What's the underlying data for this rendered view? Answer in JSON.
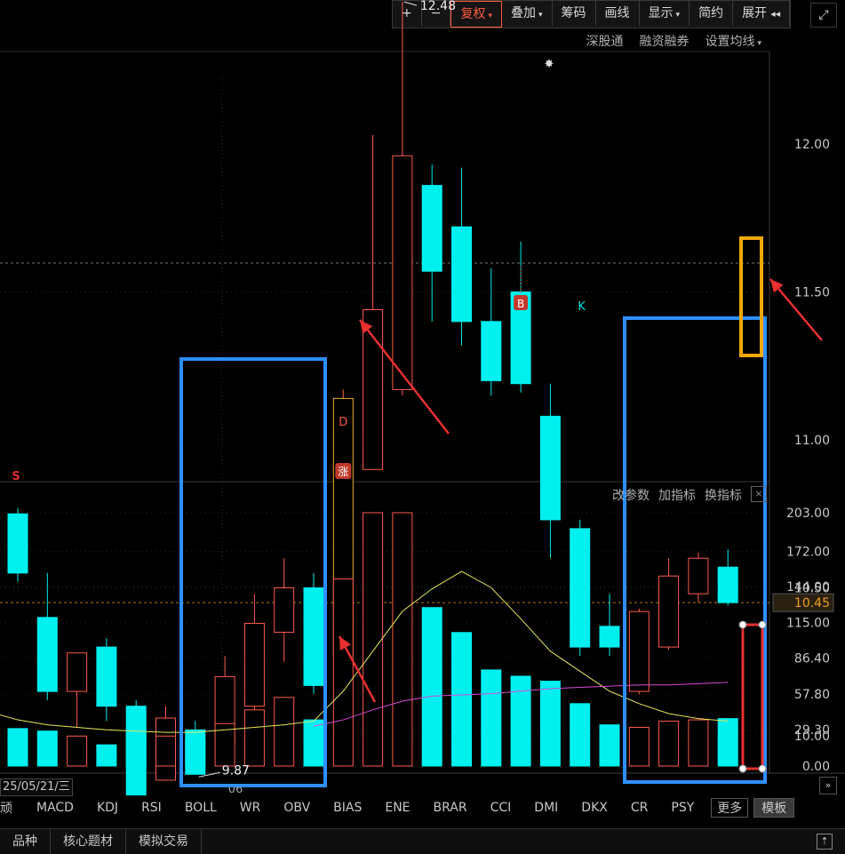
{
  "toolbar": {
    "items": [
      {
        "label": "+",
        "dropdown": false,
        "active": false
      },
      {
        "label": "−",
        "dropdown": false,
        "active": false
      },
      {
        "label": "复权",
        "dropdown": true,
        "active": true
      },
      {
        "label": "叠加",
        "dropdown": true,
        "active": false
      },
      {
        "label": "筹码",
        "dropdown": false,
        "active": false
      },
      {
        "label": "画线",
        "dropdown": false,
        "active": false
      },
      {
        "label": "显示",
        "dropdown": true,
        "active": false
      },
      {
        "label": "简约",
        "dropdown": false,
        "active": false
      },
      {
        "label": "展开",
        "dropdown": false,
        "active": false
      }
    ],
    "expand_arrows": "◂◂"
  },
  "top_links": [
    "深股通",
    "融资融券",
    "设置均线"
  ],
  "indicator_header": [
    "改参数",
    "加指标",
    "换指标"
  ],
  "indicator_close": "×",
  "date_label": "25/05/21/三",
  "month_label": "06",
  "indicator_tabs": [
    "顽",
    "MACD",
    "KDJ",
    "RSI",
    "BOLL",
    "WR",
    "OBV",
    "BIAS",
    "ENE",
    "BRAR",
    "CCI",
    "DMI",
    "DKX",
    "CR",
    "PSY"
  ],
  "tab_more": "更多",
  "tab_template": "模板",
  "bottom_tabs": [
    "品种",
    "核心题材",
    "模拟交易"
  ],
  "colors": {
    "up": "#ff5a4c",
    "down": "#00f0f0",
    "ma_yellow": "#e8e85a",
    "ma_purple": "#d84ad8",
    "price_tag": "#f0a020",
    "box_blue": "#2f8fff",
    "box_orange": "#f0a800",
    "arrow_red": "#e83030"
  },
  "chart_data": {
    "type": "candlestick",
    "price_axis": {
      "ticks": [
        "12.00",
        "11.50",
        "11.00",
        "10.50",
        "10.00"
      ],
      "current_price": "10.45"
    },
    "volume_axis": {
      "ticks": [
        "203.00",
        "172.00",
        "144.00",
        "115.00",
        "86.40",
        "57.80",
        "29.30",
        "0.00"
      ]
    },
    "annotations": {
      "high": "12.48",
      "low": "9.87",
      "markers": [
        "S",
        "D",
        "涨",
        "B",
        "K"
      ]
    },
    "candles": [
      {
        "o": 10.75,
        "h": 10.77,
        "c": 10.55,
        "l": 10.52
      },
      {
        "o": 10.4,
        "h": 10.55,
        "c": 10.15,
        "l": 10.12
      },
      {
        "o": 10.15,
        "h": 10.22,
        "c": 10.28,
        "l": 10.03
      },
      {
        "o": 10.3,
        "h": 10.33,
        "c": 10.1,
        "l": 10.05
      },
      {
        "o": 10.1,
        "h": 10.12,
        "c": 9.8,
        "l": 9.8
      },
      {
        "o": 9.85,
        "h": 10.1,
        "c": 10.06,
        "l": 9.85
      },
      {
        "o": 10.02,
        "h": 10.05,
        "c": 9.87,
        "l": 9.87
      },
      {
        "o": 9.98,
        "h": 10.27,
        "c": 10.2,
        "l": 9.9
      },
      {
        "o": 10.1,
        "h": 10.48,
        "c": 10.38,
        "l": 10.05
      },
      {
        "o": 10.35,
        "h": 10.6,
        "c": 10.5,
        "l": 10.25
      },
      {
        "o": 10.5,
        "h": 10.55,
        "c": 10.17,
        "l": 10.14
      },
      {
        "o": 10.27,
        "h": 11.17,
        "c": 11.14,
        "l": 10.25
      },
      {
        "o": 10.9,
        "h": 12.03,
        "c": 11.44,
        "l": 10.99
      },
      {
        "o": 11.17,
        "h": 12.48,
        "c": 11.96,
        "l": 11.15
      },
      {
        "o": 11.86,
        "h": 11.93,
        "c": 11.57,
        "l": 11.4
      },
      {
        "o": 11.72,
        "h": 11.92,
        "c": 11.4,
        "l": 11.32
      },
      {
        "o": 11.4,
        "h": 11.58,
        "c": 11.2,
        "l": 11.15
      },
      {
        "o": 11.5,
        "h": 11.67,
        "c": 11.19,
        "l": 11.16
      },
      {
        "o": 11.08,
        "h": 11.19,
        "c": 10.73,
        "l": 10.6
      },
      {
        "o": 10.7,
        "h": 10.73,
        "c": 10.3,
        "l": 10.27
      },
      {
        "o": 10.37,
        "h": 10.48,
        "c": 10.3,
        "l": 10.27
      },
      {
        "o": 10.15,
        "h": 10.43,
        "c": 10.42,
        "l": 10.14
      },
      {
        "o": 10.3,
        "h": 10.6,
        "c": 10.54,
        "l": 10.29
      },
      {
        "o": 10.48,
        "h": 10.62,
        "c": 10.6,
        "l": 10.45
      },
      {
        "o": 10.57,
        "h": 10.63,
        "c": 10.45,
        "l": 10.44
      }
    ],
    "volumes": [
      30,
      28,
      24,
      17,
      29,
      24,
      21,
      34,
      45,
      55,
      37,
      150,
      203,
      203,
      127,
      107,
      77,
      72,
      68,
      50,
      33,
      31,
      36,
      37,
      38
    ],
    "vol_ma_yellow": [
      37,
      33,
      31,
      29,
      28,
      27,
      27,
      29,
      31,
      33,
      36,
      60,
      92,
      124,
      142,
      156,
      143,
      118,
      92,
      76,
      60,
      50,
      42,
      38,
      36
    ],
    "vol_ma_purple": [
      null,
      null,
      null,
      null,
      null,
      null,
      null,
      null,
      null,
      null,
      32,
      37,
      45,
      52,
      56,
      57,
      58,
      60,
      62,
      63,
      64,
      65,
      65,
      66,
      67
    ]
  }
}
